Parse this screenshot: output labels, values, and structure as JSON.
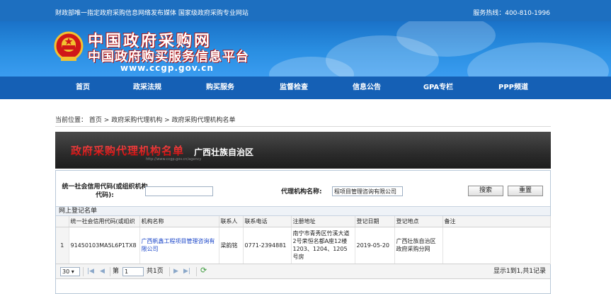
{
  "topbar": {
    "left_text": "财政部唯一指定政府采购信息网络发布媒体  国家级政府采购专业网站",
    "hotline": "服务热线：400-810-1996"
  },
  "banner": {
    "logo_line1": "中国政府采购网",
    "logo_line2": "中国政府购买服务信息平台",
    "url": "www.ccgp.gov.cn"
  },
  "nav": [
    {
      "label": "首页"
    },
    {
      "label": "政采法规"
    },
    {
      "label": "购买服务"
    },
    {
      "label": "监督检查"
    },
    {
      "label": "信息公告"
    },
    {
      "label": "GPA专栏"
    },
    {
      "label": "PPP频道"
    }
  ],
  "breadcrumb": {
    "prefix": "当前位置：",
    "items": [
      "首页",
      "政府采购代理机构",
      "政府采购代理机构名单"
    ],
    "separator": ">"
  },
  "header_block": {
    "title": "政府采购代理机构名单",
    "region": "广西壮族自治区",
    "tiny_url": "http://www.ccgp.gov.cn/agency"
  },
  "search": {
    "code_label": "统一社会信用代码(或组织机构代码):",
    "code_value": "",
    "name_label": "代理机构名称:",
    "name_value": "程项目管理咨询有限公司",
    "search_button": "搜索",
    "reset_button": "重置"
  },
  "grid": {
    "title": "网上登记名单",
    "columns": [
      "统一社会信用代码(或组织",
      "机构名称",
      "联系人",
      "联系电话",
      "注册地址",
      "登记日期",
      "登记地点",
      "备注"
    ],
    "rows": [
      {
        "num": "1",
        "code": "91450103MA5L6P1TX8",
        "name": "广西帆鑫工程项目管理咨询有限公司",
        "contact": "梁韵铭",
        "phone": "0771-2394881",
        "address": "南宁市青秀区竹溪大道2号荣恒名都A座12楼1203、1204、1205号房",
        "date": "2019-05-20",
        "place": "广西壮族自治区政府采购分网",
        "note": ""
      }
    ]
  },
  "pager": {
    "page_size": "30",
    "page_label": "第",
    "page_value": "1",
    "total_pages": "共1页",
    "info": "显示1到1,共1记录"
  },
  "colors": {
    "nav_bg": "#1560b5",
    "link": "#1a45c8"
  }
}
